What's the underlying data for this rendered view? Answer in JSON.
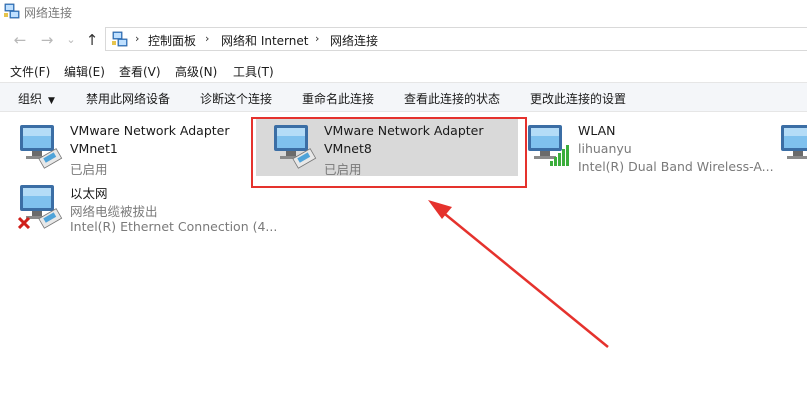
{
  "window": {
    "title": "网络连接"
  },
  "nav": {
    "back": "←",
    "forward": "→",
    "dropdown": "⌄",
    "up": "↑"
  },
  "address": {
    "crumbs": [
      "控制面板",
      "网络和 Internet",
      "网络连接"
    ],
    "separator": "›"
  },
  "menu": {
    "items": [
      "文件(F)",
      "编辑(E)",
      "查看(V)",
      "高级(N)",
      "工具(T)"
    ]
  },
  "toolbar": {
    "organize": "组织",
    "organize_caret": "▼",
    "items": [
      "禁用此网络设备",
      "诊断这个连接",
      "重命名此连接",
      "查看此连接的状态",
      "更改此连接的设置"
    ]
  },
  "connections": [
    {
      "name": "VMware Network Adapter",
      "line2": "VMnet1",
      "status": "已启用",
      "icon": "network-adapter-icon"
    },
    {
      "name": "VMware Network Adapter",
      "line2": "VMnet8",
      "status": "已启用",
      "icon": "network-adapter-icon",
      "selected": true
    },
    {
      "name": "WLAN",
      "line2": "lihuanyu",
      "status": "Intel(R) Dual Band Wireless-A...",
      "icon": "wireless-adapter-icon"
    },
    {
      "name": "以太网",
      "line2": "网络电缆被拔出",
      "status": "Intel(R) Ethernet Connection (4...",
      "icon": "ethernet-disconnected-icon"
    }
  ],
  "annotation": {
    "color": "#e5322d"
  },
  "colors": {
    "toolbar_bg": "#f4f6f9",
    "selection_bg": "#d9d9d9",
    "secondary_text": "#7a7a7a"
  }
}
